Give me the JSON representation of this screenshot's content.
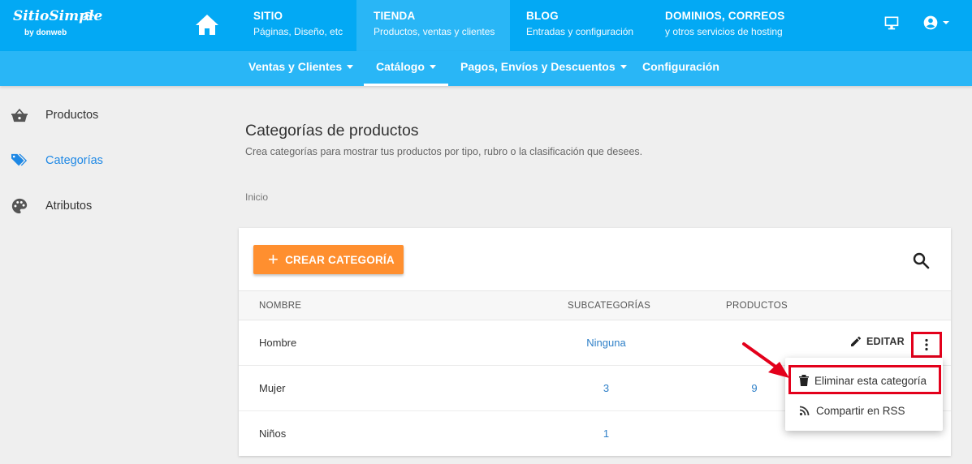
{
  "brand": {
    "name": "SitioSimple",
    "by": "by donweb"
  },
  "topnav": [
    {
      "title": "SITIO",
      "subtitle": "Páginas, Diseño, etc"
    },
    {
      "title": "TIENDA",
      "subtitle": "Productos, ventas y clientes"
    },
    {
      "title": "BLOG",
      "subtitle": "Entradas y configuración"
    },
    {
      "title": "DOMINIOS, CORREOS",
      "subtitle": "y otros servicios de hosting"
    }
  ],
  "subnav": [
    {
      "label": "Ventas y Clientes"
    },
    {
      "label": "Catálogo"
    },
    {
      "label": "Pagos, Envíos y Descuentos"
    },
    {
      "label": "Configuración"
    }
  ],
  "sidebar": [
    {
      "label": "Productos",
      "icon": "basket-icon"
    },
    {
      "label": "Categorías",
      "icon": "tag-icon"
    },
    {
      "label": "Atributos",
      "icon": "palette-icon"
    }
  ],
  "page": {
    "title": "Categorías de productos",
    "subtitle": "Crea categorías para mostrar tus productos por tipo, rubro o la clasificación que desees.",
    "breadcrumb": "Inicio"
  },
  "card": {
    "create_label": "CREAR CATEGORÍA",
    "columns": [
      "NOMBRE",
      "SUBCATEGORÍAS",
      "PRODUCTOS"
    ],
    "rows": [
      {
        "name": "Hombre",
        "subcategories": "Ninguna",
        "products": ""
      },
      {
        "name": "Mujer",
        "subcategories": "3",
        "products": "9"
      },
      {
        "name": "Niños",
        "subcategories": "1",
        "products": ""
      }
    ],
    "edit_label": "EDITAR"
  },
  "menu": {
    "items": [
      {
        "label": "Eliminar esta categoría",
        "icon": "trash-icon"
      },
      {
        "label": "Compartir en RSS",
        "icon": "rss-icon"
      }
    ]
  },
  "colors": {
    "primary": "#03a9f4",
    "primary_light": "#29b6f6",
    "accent": "#ff8f2f",
    "link": "#2f80c8",
    "highlight": "#e3001b"
  }
}
